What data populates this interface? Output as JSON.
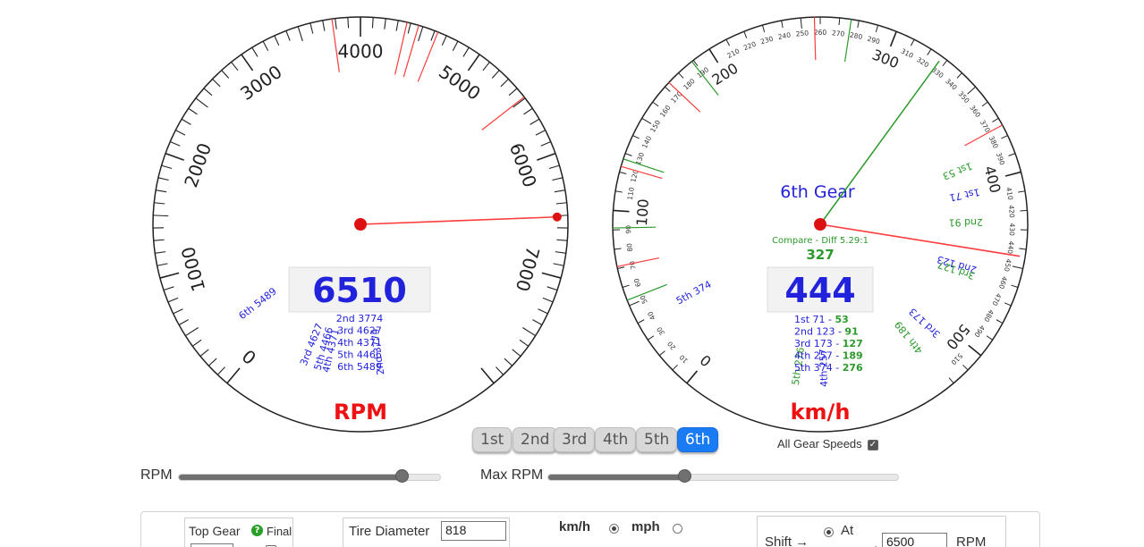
{
  "rpm_gauge": {
    "max_value": 8000,
    "major_labels": [
      "0",
      "1000",
      "2000",
      "3000",
      "4000",
      "5000",
      "6000",
      "7000"
    ],
    "current_value": "6510",
    "current_rpm": 6510,
    "needle_color": "#ff3b3b",
    "unit_label": "RPM",
    "shift_marks": [
      {
        "gear": "2nd",
        "rpm": "3774"
      },
      {
        "gear": "3rd",
        "rpm": "4627"
      },
      {
        "gear": "4th",
        "rpm": "4371"
      },
      {
        "gear": "5th",
        "rpm": "4466"
      },
      {
        "gear": "6th",
        "rpm": "5489"
      }
    ],
    "readout_list": [
      {
        "gear": "2nd",
        "rpm": "3774"
      },
      {
        "gear": "3rd",
        "rpm": "4627"
      },
      {
        "gear": "4th",
        "rpm": "4371"
      },
      {
        "gear": "5th",
        "rpm": "4466"
      },
      {
        "gear": "6th",
        "rpm": "5489"
      }
    ]
  },
  "speed_gauge": {
    "max_value": 520,
    "major_labels": [
      "0",
      "100",
      "200",
      "300",
      "400",
      "500"
    ],
    "minor_labels": [
      "10",
      "20",
      "30",
      "40",
      "50",
      "60",
      "70",
      "80",
      "90",
      "110",
      "120",
      "130",
      "140",
      "150",
      "160",
      "170",
      "180",
      "190",
      "210",
      "220",
      "230",
      "240",
      "250",
      "260",
      "270",
      "280",
      "290",
      "310",
      "320",
      "330",
      "340",
      "350",
      "360",
      "370",
      "380",
      "390",
      "410",
      "420",
      "430",
      "440",
      "450",
      "460",
      "470",
      "480",
      "490",
      "510"
    ],
    "current_value": "444",
    "current_speed": 444,
    "compare_speed": 327,
    "gear_title": "6th Gear",
    "compare_label": "Compare - Diff 5.29:1",
    "compare_value": "327",
    "unit_label": "km/h",
    "blue_marks": [
      {
        "gear": "1st",
        "speed": "71"
      },
      {
        "gear": "2nd",
        "speed": "123"
      },
      {
        "gear": "3rd",
        "speed": "173"
      },
      {
        "gear": "4th",
        "speed": "257"
      },
      {
        "gear": "5th",
        "speed": "374"
      }
    ],
    "green_marks": [
      {
        "gear": "1st",
        "speed": "53"
      },
      {
        "gear": "2nd",
        "speed": "91"
      },
      {
        "gear": "3rd",
        "speed": "127"
      },
      {
        "gear": "4th",
        "speed": "189"
      },
      {
        "gear": "5th",
        "speed": "276"
      }
    ],
    "readout_list": [
      {
        "gear": "1st",
        "speed": "71",
        "compare": "53"
      },
      {
        "gear": "2nd",
        "speed": "123",
        "compare": "91"
      },
      {
        "gear": "3rd",
        "speed": "173",
        "compare": "127"
      },
      {
        "gear": "4th",
        "speed": "257",
        "compare": "189"
      },
      {
        "gear": "5th",
        "speed": "374",
        "compare": "276"
      }
    ],
    "all_gear_speeds_label": "All Gear Speeds",
    "all_gear_speeds_checked": true
  },
  "gear_buttons": {
    "items": [
      "1st",
      "2nd",
      "3rd",
      "4th",
      "5th",
      "6th"
    ],
    "selected": "6th"
  },
  "sliders": {
    "rpm_label": "RPM",
    "rpm_fraction": 0.85,
    "max_rpm_label": "Max RPM",
    "max_rpm_fraction": 0.39
  },
  "settings": {
    "top_gear_label": "Top Gear",
    "final_label": "Final",
    "tire_diameter_label": "Tire Diameter",
    "tire_diameter_value": "818",
    "unit_kmh_label": "km/h",
    "unit_mph_label": "mph",
    "unit_selected": "km/h",
    "shift_label": "Shift →",
    "at_label": "At",
    "shift_arrow": "→",
    "shift_rpm_value": "6500",
    "shift_rpm_unit": "RPM"
  },
  "colors": {
    "red": "#ff3b3b",
    "blue_text": "#2222dd",
    "green_text": "#2b9a2b",
    "gauge_label_red": "#ee1111",
    "active_button": "#1a7cf5"
  }
}
